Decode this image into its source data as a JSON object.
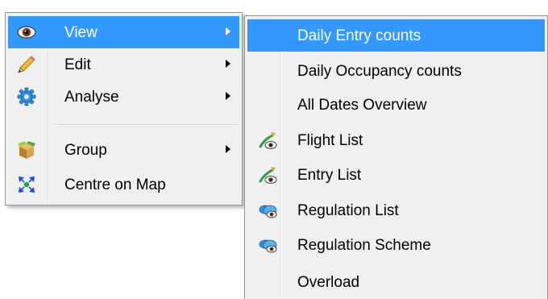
{
  "main_menu": {
    "items": [
      {
        "label": "View",
        "icon": "eye-icon",
        "has_submenu": true,
        "highlighted": true
      },
      {
        "label": "Edit",
        "icon": "pencil-icon",
        "has_submenu": true,
        "highlighted": false
      },
      {
        "label": "Analyse",
        "icon": "gear-icon",
        "has_submenu": true,
        "highlighted": false
      },
      {
        "label": "Group",
        "icon": "box-icon",
        "has_submenu": true,
        "highlighted": false
      },
      {
        "label": "Centre on Map",
        "icon": "crosshair-icon",
        "has_submenu": false,
        "highlighted": false
      }
    ]
  },
  "view_submenu": {
    "items": [
      {
        "label": "Daily Entry counts",
        "icon": "",
        "highlighted": true
      },
      {
        "label": "Daily Occupancy counts",
        "icon": "",
        "highlighted": false
      },
      {
        "label": "All Dates Overview",
        "icon": "",
        "highlighted": false
      },
      {
        "label": "Flight List",
        "icon": "flight-list-icon",
        "highlighted": false
      },
      {
        "label": "Entry List",
        "icon": "flight-list-icon",
        "highlighted": false
      },
      {
        "label": "Regulation List",
        "icon": "regulation-icon",
        "highlighted": false
      },
      {
        "label": "Regulation Scheme",
        "icon": "regulation-icon",
        "highlighted": false
      },
      {
        "label": "Overload",
        "icon": "",
        "highlighted": false
      }
    ]
  },
  "colors": {
    "menu_bg": "#f0f0f0",
    "highlight": "#3399ff",
    "border": "#979797"
  }
}
